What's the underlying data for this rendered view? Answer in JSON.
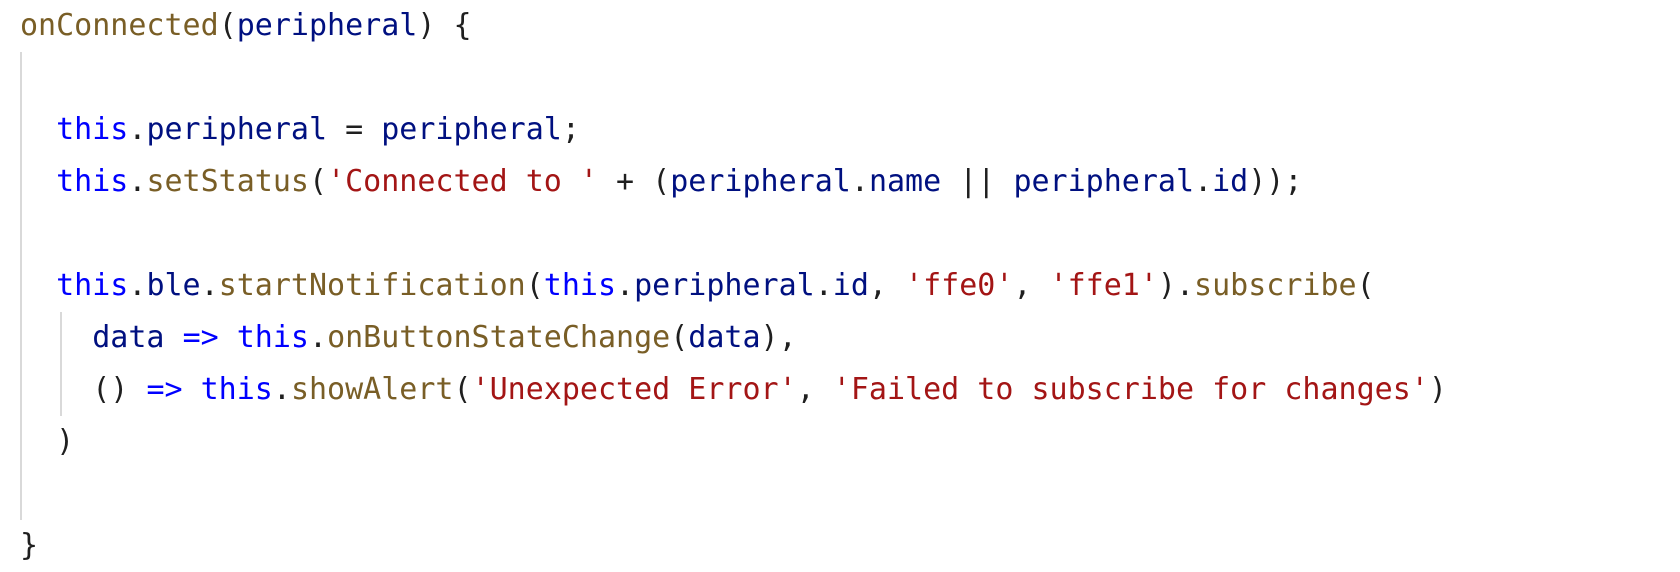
{
  "editor": {
    "colors": {
      "keyword": "#0000ff",
      "function": "#795e26",
      "variable": "#001080",
      "string": "#a31515",
      "punctuation": "#1f1f1f",
      "indent_guide": "#d9d9d9"
    },
    "lines": [
      [
        {
          "t": "onConnected",
          "c": "fn"
        },
        {
          "t": "(",
          "c": "op"
        },
        {
          "t": "peripheral",
          "c": "var"
        },
        {
          "t": ") {",
          "c": "op"
        }
      ],
      [],
      [
        {
          "t": "  ",
          "c": "op"
        },
        {
          "t": "this",
          "c": "kw"
        },
        {
          "t": ".",
          "c": "op"
        },
        {
          "t": "peripheral",
          "c": "var"
        },
        {
          "t": " = ",
          "c": "op"
        },
        {
          "t": "peripheral",
          "c": "var"
        },
        {
          "t": ";",
          "c": "op"
        }
      ],
      [
        {
          "t": "  ",
          "c": "op"
        },
        {
          "t": "this",
          "c": "kw"
        },
        {
          "t": ".",
          "c": "op"
        },
        {
          "t": "setStatus",
          "c": "fn"
        },
        {
          "t": "(",
          "c": "op"
        },
        {
          "t": "'Connected to '",
          "c": "str"
        },
        {
          "t": " + (",
          "c": "op"
        },
        {
          "t": "peripheral",
          "c": "var"
        },
        {
          "t": ".",
          "c": "op"
        },
        {
          "t": "name",
          "c": "var"
        },
        {
          "t": " || ",
          "c": "op"
        },
        {
          "t": "peripheral",
          "c": "var"
        },
        {
          "t": ".",
          "c": "op"
        },
        {
          "t": "id",
          "c": "var"
        },
        {
          "t": "));",
          "c": "op"
        }
      ],
      [],
      [
        {
          "t": "  ",
          "c": "op"
        },
        {
          "t": "this",
          "c": "kw"
        },
        {
          "t": ".",
          "c": "op"
        },
        {
          "t": "ble",
          "c": "var"
        },
        {
          "t": ".",
          "c": "op"
        },
        {
          "t": "startNotification",
          "c": "fn"
        },
        {
          "t": "(",
          "c": "op"
        },
        {
          "t": "this",
          "c": "kw"
        },
        {
          "t": ".",
          "c": "op"
        },
        {
          "t": "peripheral",
          "c": "var"
        },
        {
          "t": ".",
          "c": "op"
        },
        {
          "t": "id",
          "c": "var"
        },
        {
          "t": ", ",
          "c": "op"
        },
        {
          "t": "'ffe0'",
          "c": "str"
        },
        {
          "t": ", ",
          "c": "op"
        },
        {
          "t": "'ffe1'",
          "c": "str"
        },
        {
          "t": ").",
          "c": "op"
        },
        {
          "t": "subscribe",
          "c": "fn"
        },
        {
          "t": "(",
          "c": "op"
        }
      ],
      [
        {
          "t": "    ",
          "c": "op"
        },
        {
          "t": "data",
          "c": "var"
        },
        {
          "t": " ",
          "c": "op"
        },
        {
          "t": "=>",
          "c": "arrow"
        },
        {
          "t": " ",
          "c": "op"
        },
        {
          "t": "this",
          "c": "kw"
        },
        {
          "t": ".",
          "c": "op"
        },
        {
          "t": "onButtonStateChange",
          "c": "fn"
        },
        {
          "t": "(",
          "c": "op"
        },
        {
          "t": "data",
          "c": "var"
        },
        {
          "t": "),",
          "c": "op"
        }
      ],
      [
        {
          "t": "    () ",
          "c": "op"
        },
        {
          "t": "=>",
          "c": "arrow"
        },
        {
          "t": " ",
          "c": "op"
        },
        {
          "t": "this",
          "c": "kw"
        },
        {
          "t": ".",
          "c": "op"
        },
        {
          "t": "showAlert",
          "c": "fn"
        },
        {
          "t": "(",
          "c": "op"
        },
        {
          "t": "'Unexpected Error'",
          "c": "str"
        },
        {
          "t": ", ",
          "c": "op"
        },
        {
          "t": "'Failed to subscribe for changes'",
          "c": "str"
        },
        {
          "t": ")",
          "c": "op"
        }
      ],
      [
        {
          "t": "  )",
          "c": "op"
        }
      ],
      [],
      [
        {
          "t": "}",
          "c": "op"
        }
      ]
    ]
  }
}
